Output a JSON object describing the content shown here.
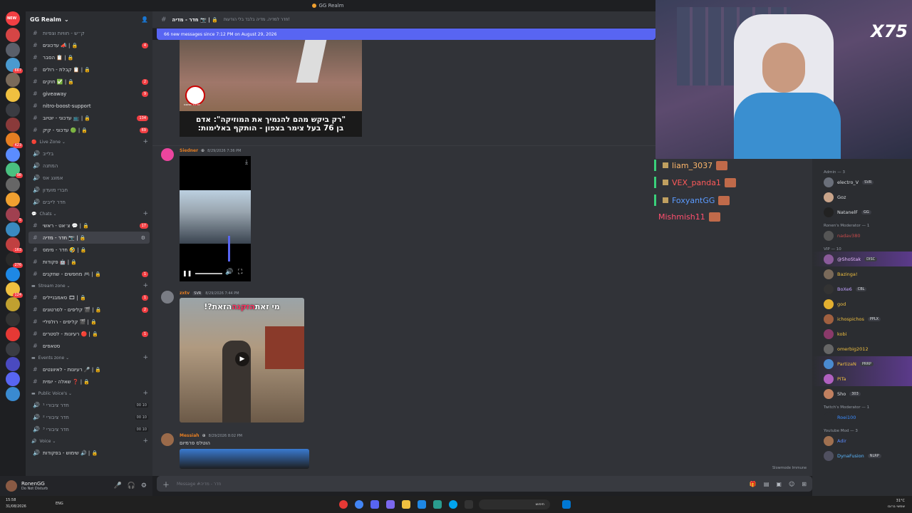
{
  "window": {
    "title": "GG Realm"
  },
  "guild": {
    "name": "GG Realm",
    "new_badge": "NEW"
  },
  "server_badges": [
    "",
    "",
    "667",
    "",
    "",
    "",
    "",
    "423",
    "",
    "98",
    "",
    "",
    "5",
    "",
    "163",
    "276",
    "",
    "124",
    "",
    "",
    "",
    "",
    "",
    "",
    ""
  ],
  "channels": {
    "top": [
      {
        "label": "ק״ש - חוויות וצפיות",
        "cnt": "",
        "color": "#949ba4"
      },
      {
        "label": "עדכונים 📣 | 🔒",
        "cnt": "4",
        "color": "#dbdee1"
      },
      {
        "label": "הסבר 📋 | 🔒",
        "cnt": "",
        "color": "#dbdee1"
      },
      {
        "label": "קבלת - רולים 📋 | 🔒",
        "cnt": "",
        "color": "#dbdee1"
      },
      {
        "label": "חוקים ✅ | 🔒",
        "cnt": "2",
        "color": "#dbdee1"
      },
      {
        "label": "giveaway",
        "cnt": "9",
        "color": "#dbdee1"
      },
      {
        "label": "nitro-boost-support",
        "cnt": "",
        "color": "#dbdee1"
      },
      {
        "label": "עדכוני - יוטיוב 📺 | 🔒",
        "cnt": "134",
        "color": "#dbdee1"
      },
      {
        "label": "עדכוני - קיק 🟢 | 🔒",
        "cnt": "69",
        "color": "#dbdee1"
      }
    ],
    "live_zone": {
      "title": "Live Zone",
      "items": [
        "בלייב",
        "המתנה",
        "אמונג אס",
        "חברי מועדון",
        "חדר לייבים"
      ]
    },
    "chats": {
      "title": "Chats",
      "items": [
        {
          "label": "צ׳אט - ראשי 💬 | 🔒",
          "cnt": "17",
          "selected": false
        },
        {
          "label": "חדר - מדיה 📷 | 🔒",
          "cnt": "",
          "selected": true
        },
        {
          "label": "חדר - מימס 🤣 | 🔒",
          "cnt": "",
          "selected": false
        },
        {
          "label": "פקודות 🤖 | 🔒",
          "cnt": "",
          "selected": false
        },
        {
          "label": "מחפשים - שחקנים 🎮 | 🔒",
          "cnt": "1",
          "selected": false
        }
      ]
    },
    "stream_zone": {
      "title": "Stream zone",
      "items": [
        {
          "label": "סאמבניילים 🎞 | 🔒",
          "cnt": "1"
        },
        {
          "label": "קליפים - לסרטונים 🎬 | 🔒",
          "cnt": "2"
        },
        {
          "label": "קליפים - רולפליי 🎬 | 🔒",
          "cnt": ""
        },
        {
          "label": "רעיונות - לסטרים 🔴 | 🔒",
          "cnt": "1"
        },
        {
          "label": "סטאפים",
          "cnt": ""
        }
      ]
    },
    "events_zone": {
      "title": "Events zone",
      "items": [
        "רעיונות - לאיוונטים 🎤 | 🔒",
        "שאלה - יומית ❓ | 🔒"
      ]
    },
    "public_voice": {
      "title": "Public Voice's",
      "items": [
        {
          "label": "חדר ציבורי ¹",
          "count": "00",
          "limit": "10"
        },
        {
          "label": "חדר ציבורי ²",
          "count": "00",
          "limit": "10"
        },
        {
          "label": "חדר ציבורי ³",
          "count": "00",
          "limit": "10"
        }
      ]
    },
    "voice": {
      "title": "Voice",
      "items": [
        "שימוש - בפקודות 🔊 | 🔒"
      ]
    }
  },
  "user": {
    "name": "RonenGG",
    "status": "Do Not Disturb"
  },
  "header": {
    "channel": "חדר - מדיה 📷 | 🔒",
    "topic": "חדר למדיה. מדיה בלבד בלי הודעות!"
  },
  "new_messages": "66 new messages since 7:12 PM on August 29, 2026",
  "messages": [
    {
      "caption_line1": "\"רק ביקש מהם להנמיך את המוזיקה\": אדם",
      "caption_line2": "בן 76 בעל צימר בצפון - הותקף באלימות:",
      "watermark": "ישראל שמנוס"
    },
    {
      "user": "Siedner",
      "color": "#e67e22",
      "time": "8/29/2026 7:36 PM"
    },
    {
      "user": "zxtv",
      "tag": "SVR",
      "color": "#e67e22",
      "time": "8/29/2026 7:44 PM",
      "video_title_a": "מי זאת ",
      "video_title_b": "הזקנה",
      "video_title_c": " הזאת?!"
    },
    {
      "user": "Messiah",
      "color": "#e67e22",
      "time": "8/29/2026 8:02 PM",
      "text": "הוטלס פרמיום"
    }
  ],
  "composer": {
    "placeholder": "Message #חדר - מדיה"
  },
  "stream_chat": [
    {
      "name": "liam_3037",
      "color": "#ffb86b"
    },
    {
      "name": "VEX_panda1",
      "color": "#ff5a5a"
    },
    {
      "name": "FoxyantGG",
      "color": "#5b9bff"
    },
    {
      "name": "Mishmish11",
      "color": "#ff4f6e"
    }
  ],
  "members": {
    "groups": [
      {
        "title": "Admin — 3",
        "items": [
          {
            "name": "electro_V",
            "color": "#dbdee1",
            "tag": "SVR",
            "av": "#6a6f7a",
            "hl": false
          },
          {
            "name": "Goz",
            "color": "#dbdee1",
            "tag": "",
            "av": "#c9a48a",
            "hl": false
          },
          {
            "name": "NatanelF",
            "color": "#dbdee1",
            "tag": "GG",
            "av": "#222",
            "hl": false
          }
        ]
      },
      {
        "title": "Ronen's Moderator — 1",
        "items": [
          {
            "name": "nadav380",
            "color": "#c94b4b",
            "tag": "",
            "av": "#555",
            "hl": false
          }
        ]
      },
      {
        "title": "VIP — 10",
        "items": [
          {
            "name": "@ShoStak",
            "color": "#e7b8ff",
            "tag": "DISC",
            "av": "#8a5a9a",
            "hl": true
          },
          {
            "name": "Bazinga!",
            "color": "#f0c040",
            "tag": "",
            "av": "#7a6a5a",
            "hl": false
          },
          {
            "name": "BoXe6",
            "color": "#c0a0ff",
            "tag": "CBL",
            "av": "#333",
            "hl": false
          },
          {
            "name": "god",
            "color": "#f0c040",
            "tag": "",
            "av": "#e3b030",
            "hl": false
          },
          {
            "name": "ichospichos",
            "color": "#f0c040",
            "tag": "PPLX",
            "av": "#a06040",
            "hl": false
          },
          {
            "name": "kobi",
            "color": "#f0c040",
            "tag": "",
            "av": "#8a3a6a",
            "hl": false
          },
          {
            "name": "omerbig2012",
            "color": "#f0c040",
            "tag": "",
            "av": "#666",
            "hl": false
          },
          {
            "name": "PartizaN",
            "color": "#f0c040",
            "tag": "PRRP",
            "av": "#4a8ad0",
            "hl": true
          },
          {
            "name": "PiTa",
            "color": "#f0c040",
            "tag": "",
            "av": "#b060c0",
            "hl": true
          },
          {
            "name": "Sho",
            "color": "#dbdee1",
            "tag": "303",
            "av": "#c08060",
            "hl": false
          }
        ]
      },
      {
        "title": "Twitch's Moderator — 1",
        "items": [
          {
            "name": "Roei100",
            "color": "#3a8cff",
            "tag": "",
            "av": "#2b2d31",
            "hl": false
          }
        ]
      },
      {
        "title": "Youtube Mod — 3",
        "items": [
          {
            "name": "Adir",
            "color": "#5b8cff",
            "tag": "",
            "av": "#a07050",
            "hl": false
          },
          {
            "name": "DynaFusion",
            "color": "#5bb8ff",
            "tag": "NLRP",
            "av": "#505060",
            "hl": false
          }
        ]
      }
    ]
  },
  "slowmode": "Slowmode Immune",
  "cam_overlay": "X75",
  "taskbar": {
    "time": "15:58",
    "date": "31/08/2026",
    "lang": "ENG",
    "weather": "31°C",
    "weather_desc": "שמשי ברובו",
    "search": "חיפוש"
  }
}
